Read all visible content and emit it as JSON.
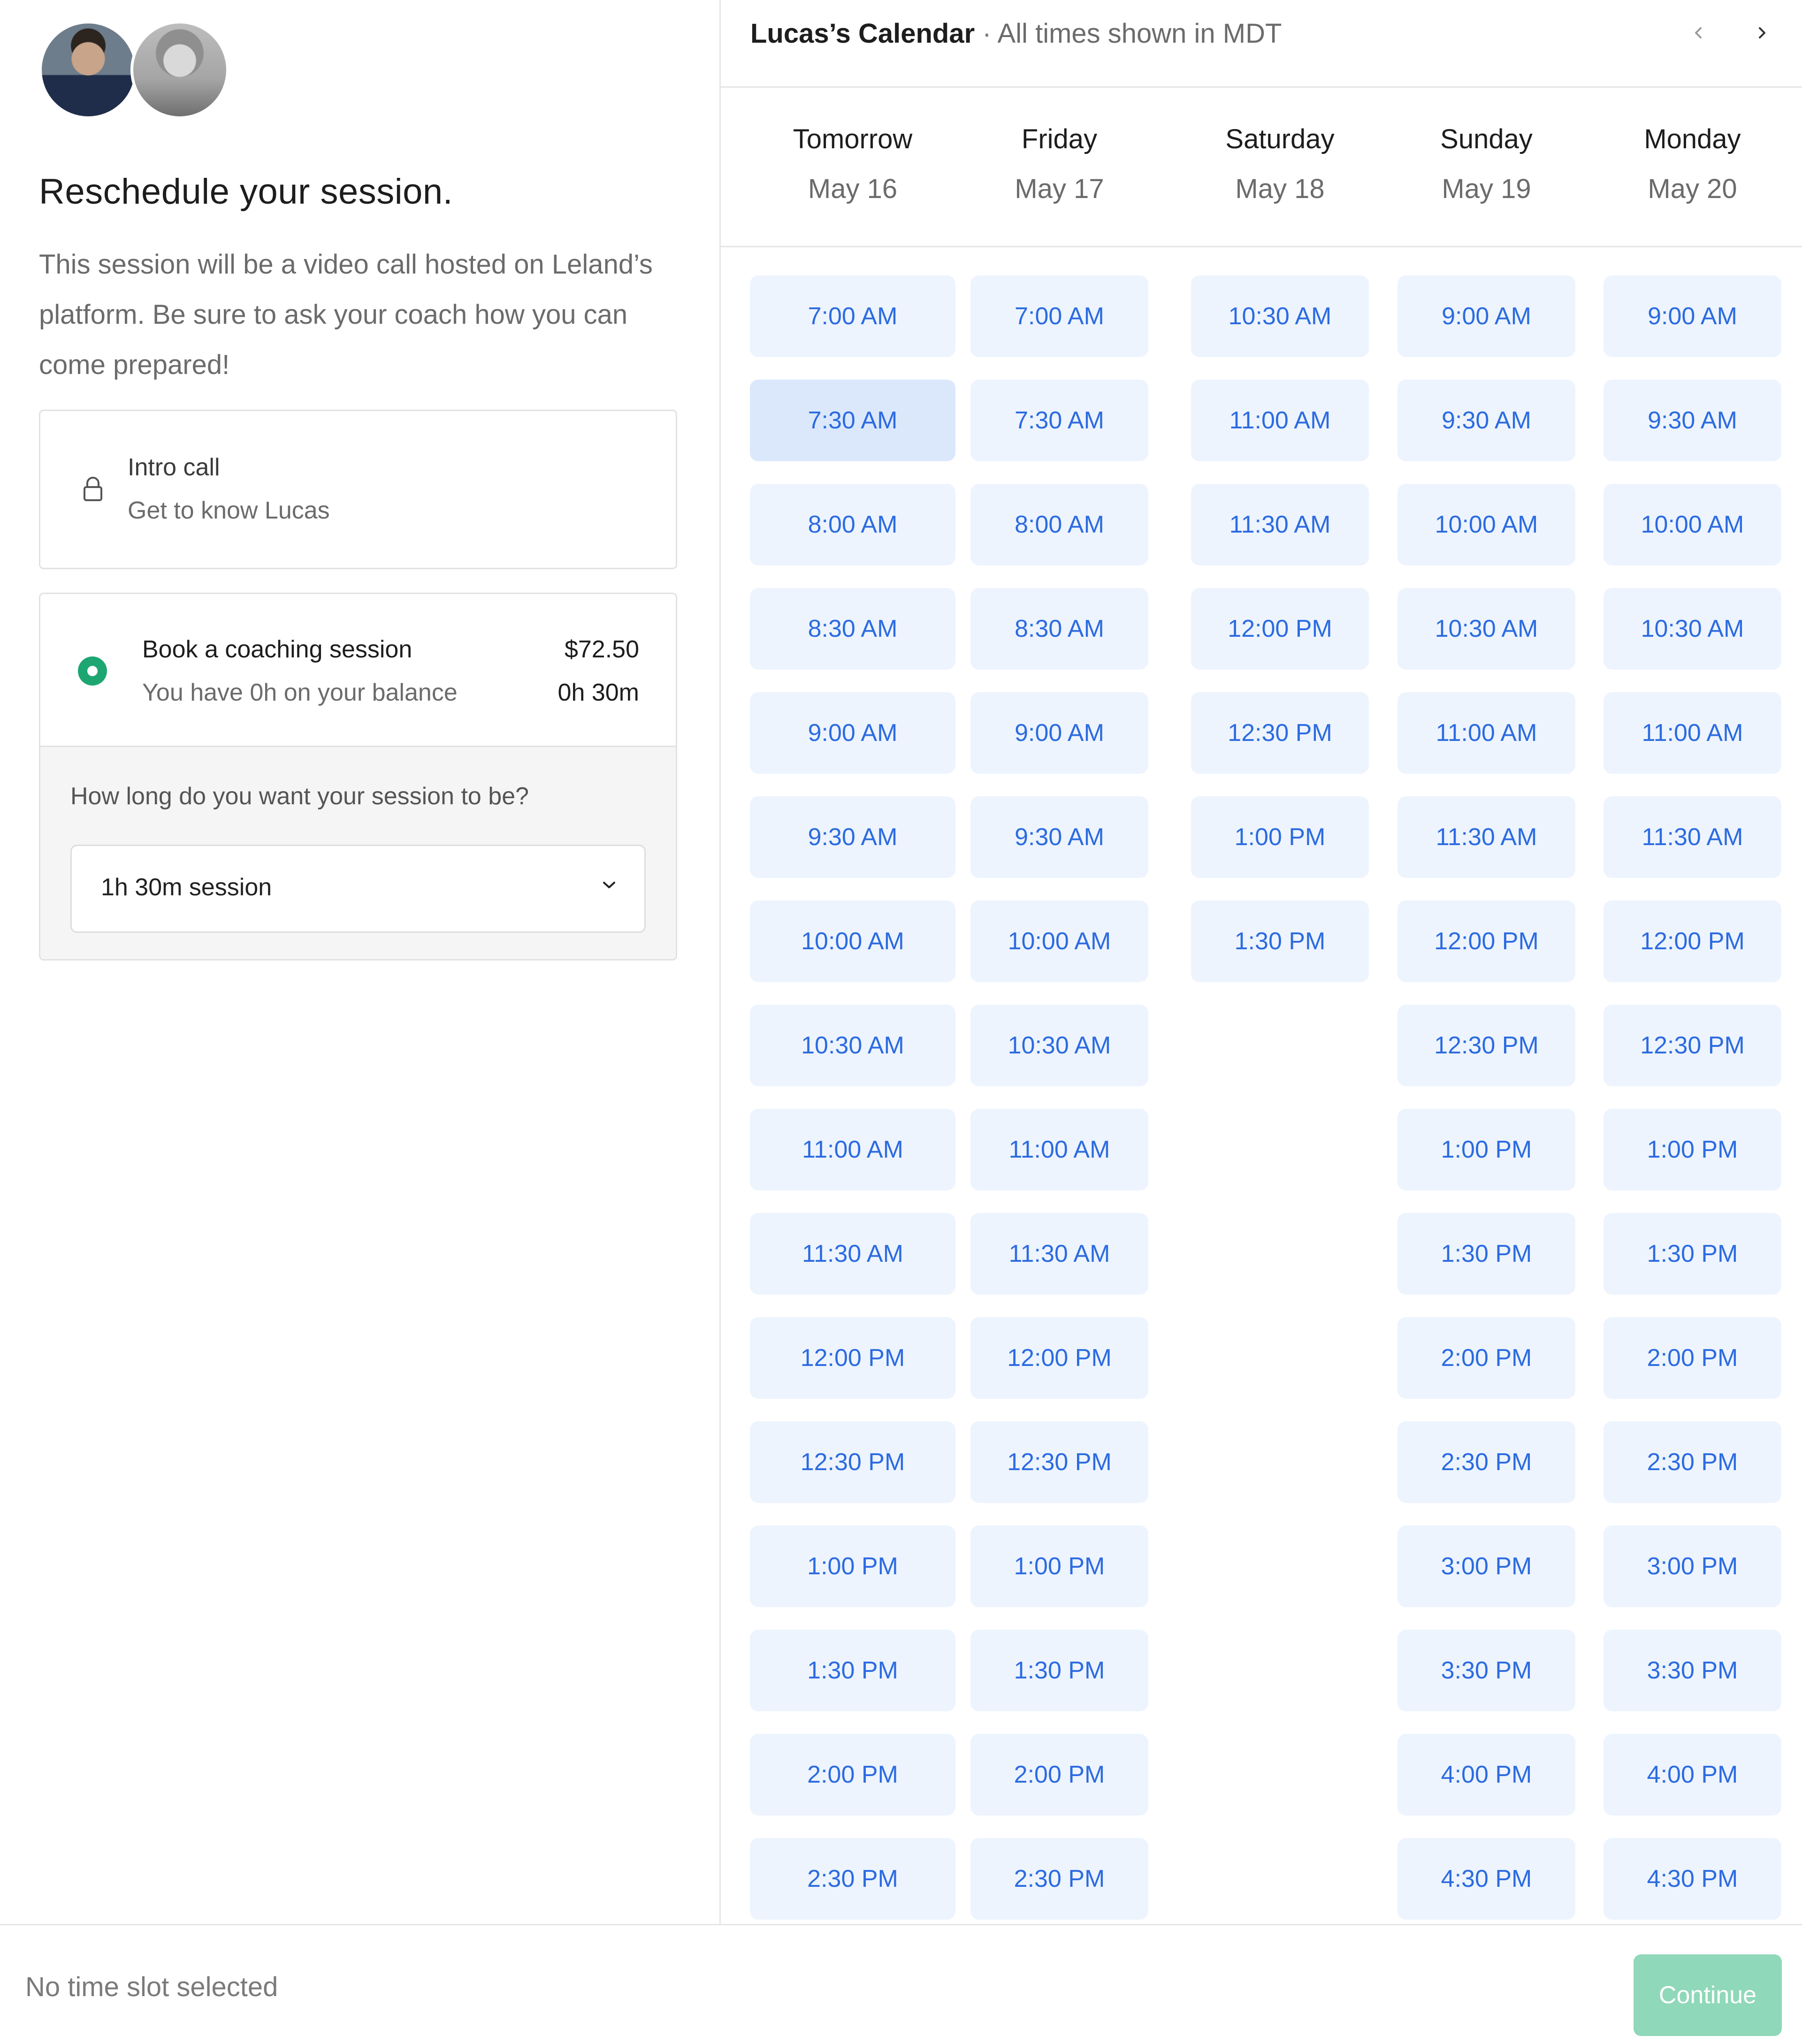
{
  "sidebar": {
    "title": "Reschedule your session.",
    "description": "This session will be a video call hosted on Leland’s platform. Be sure to ask your coach how you can come prepared!",
    "intro_card": {
      "title": "Intro call",
      "subtitle": "Get to know Lucas",
      "icon": "lock-icon"
    },
    "coaching_card": {
      "title": "Book a coaching session",
      "subtitle": "You have 0h on your balance",
      "price": "$72.50",
      "duration": "0h 30m",
      "selected": true,
      "length_question": "How long do you want your session to be?",
      "length_value": "1h 30m session"
    }
  },
  "calendar": {
    "title": "Lucas’s Calendar",
    "separator": " · ",
    "timezone_note": "All times shown in MDT",
    "prev_icon": "chevron-left-icon",
    "next_icon": "chevron-right-icon",
    "days": [
      {
        "name": "Tomorrow",
        "date": "May 16",
        "slots": [
          "7:00 AM",
          "7:30 AM",
          "8:00 AM",
          "8:30 AM",
          "9:00 AM",
          "9:30 AM",
          "10:00 AM",
          "10:30 AM",
          "11:00 AM",
          "11:30 AM",
          "12:00 PM",
          "12:30 PM",
          "1:00 PM",
          "1:30 PM",
          "2:00 PM",
          "2:30 PM"
        ]
      },
      {
        "name": "Friday",
        "date": "May 17",
        "slots": [
          "7:00 AM",
          "7:30 AM",
          "8:00 AM",
          "8:30 AM",
          "9:00 AM",
          "9:30 AM",
          "10:00 AM",
          "10:30 AM",
          "11:00 AM",
          "11:30 AM",
          "12:00 PM",
          "12:30 PM",
          "1:00 PM",
          "1:30 PM",
          "2:00 PM",
          "2:30 PM"
        ]
      },
      {
        "name": "Saturday",
        "date": "May 18",
        "slots": [
          "10:30 AM",
          "11:00 AM",
          "11:30 AM",
          "12:00 PM",
          "12:30 PM",
          "1:00 PM",
          "1:30 PM"
        ]
      },
      {
        "name": "Sunday",
        "date": "May 19",
        "slots": [
          "9:00 AM",
          "9:30 AM",
          "10:00 AM",
          "10:30 AM",
          "11:00 AM",
          "11:30 AM",
          "12:00 PM",
          "12:30 PM",
          "1:00 PM",
          "1:30 PM",
          "2:00 PM",
          "2:30 PM",
          "3:00 PM",
          "3:30 PM",
          "4:00 PM",
          "4:30 PM"
        ]
      },
      {
        "name": "Monday",
        "date": "May 20",
        "slots": [
          "9:00 AM",
          "9:30 AM",
          "10:00 AM",
          "10:30 AM",
          "11:00 AM",
          "11:30 AM",
          "12:00 PM",
          "12:30 PM",
          "1:00 PM",
          "1:30 PM",
          "2:00 PM",
          "2:30 PM",
          "3:00 PM",
          "3:30 PM",
          "4:00 PM",
          "4:30 PM"
        ]
      }
    ]
  },
  "footer": {
    "status": "No time slot selected",
    "continue_label": "Continue"
  },
  "colors": {
    "slot_bg": "#edf4fe",
    "slot_text": "#2c6be0",
    "radio_green": "#1ea672",
    "continue_bg": "#8fd8b9"
  }
}
